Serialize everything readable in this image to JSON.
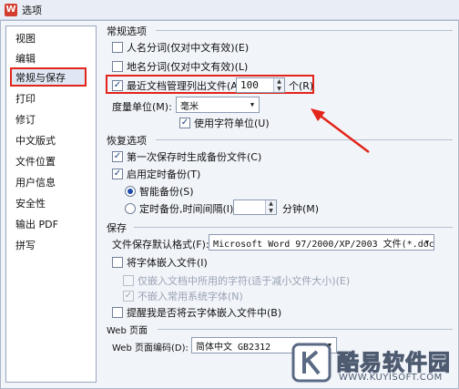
{
  "window": {
    "title": "选项"
  },
  "sidebar": {
    "items": [
      {
        "label": "视图"
      },
      {
        "label": "编辑"
      },
      {
        "label": "常规与保存"
      },
      {
        "label": "打印"
      },
      {
        "label": "修订"
      },
      {
        "label": "中文版式"
      },
      {
        "label": "文件位置"
      },
      {
        "label": "用户信息"
      },
      {
        "label": "安全性"
      },
      {
        "label": "输出 PDF"
      },
      {
        "label": "拼写"
      }
    ]
  },
  "general": {
    "title": "常规选项",
    "word_segmentation": "人名分词(仅对中文有效)(E)",
    "place_segmentation": "地名分词(仅对中文有效)(L)",
    "recent_files_label": "最近文档管理列出文件(A):",
    "recent_files_value": "100",
    "recent_files_unit": "个(R)",
    "measure_unit_label": "度量单位(M):",
    "measure_unit_value": "毫米",
    "use_char_unit": "使用字符单位(U)"
  },
  "recovery": {
    "title": "恢复选项",
    "first_save_backup": "第一次保存时生成备份文件(C)",
    "enable_timed_backup": "启用定时备份(T)",
    "smart_backup": "智能备份(S)",
    "timed_backup_label": "定时备份,时间间隔(I):",
    "timed_backup_value": "",
    "timed_backup_unit": "分钟(M)"
  },
  "save": {
    "title": "保存",
    "default_format_label": "文件保存默认格式(F):",
    "default_format_value": "Microsoft Word 97/2000/XP/2003 文件(*.doc)",
    "embed_fonts": "将字体嵌入文件(I)",
    "embed_used_chars": "仅嵌入文档中所用的字符(适于减小文件大小)(E)",
    "no_embed_system_fonts": "不嵌入常用系统字体(N)",
    "remind_cloud_fonts": "提醒我是否将云字体嵌入文件中(B)"
  },
  "web": {
    "title": "Web 页面",
    "encoding_label": "Web 页面编码(D):",
    "encoding_value": "简体中文 GB2312"
  },
  "watermark": {
    "brand": "酷易软件园",
    "url": "WWW.KUYISOFT.COM"
  },
  "colors": {
    "highlight_red": "#e2241a",
    "accent_blue": "#1f4aa8"
  }
}
